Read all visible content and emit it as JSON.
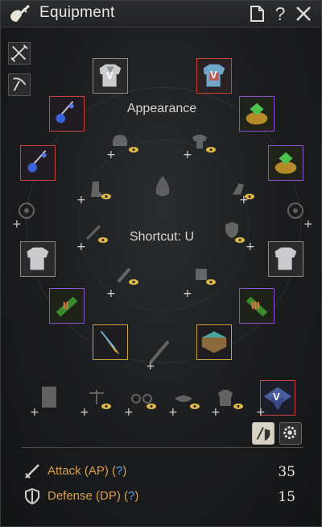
{
  "window": {
    "title": "Equipment",
    "help_label": "?"
  },
  "center": {
    "appearance_label": "Appearance",
    "shortcut_label": "Shortcut: U"
  },
  "slots": {
    "awakening_mark": "V",
    "talisman_mark": "II",
    "talisman_mark_right": "III"
  },
  "stats": {
    "attack_label": "Attack (AP) (",
    "attack_q": "?",
    "attack_close": ")",
    "attack_value": "35",
    "defense_label": "Defense (DP) (",
    "defense_q": "?",
    "defense_close": ")",
    "defense_value": "15"
  },
  "colors": {
    "accent_gold": "#d9a04e",
    "help_blue": "#5aa6e8",
    "rare_red": "#c8433e",
    "rare_purple": "#8a55c9",
    "rare_gold": "#c8a04a"
  }
}
